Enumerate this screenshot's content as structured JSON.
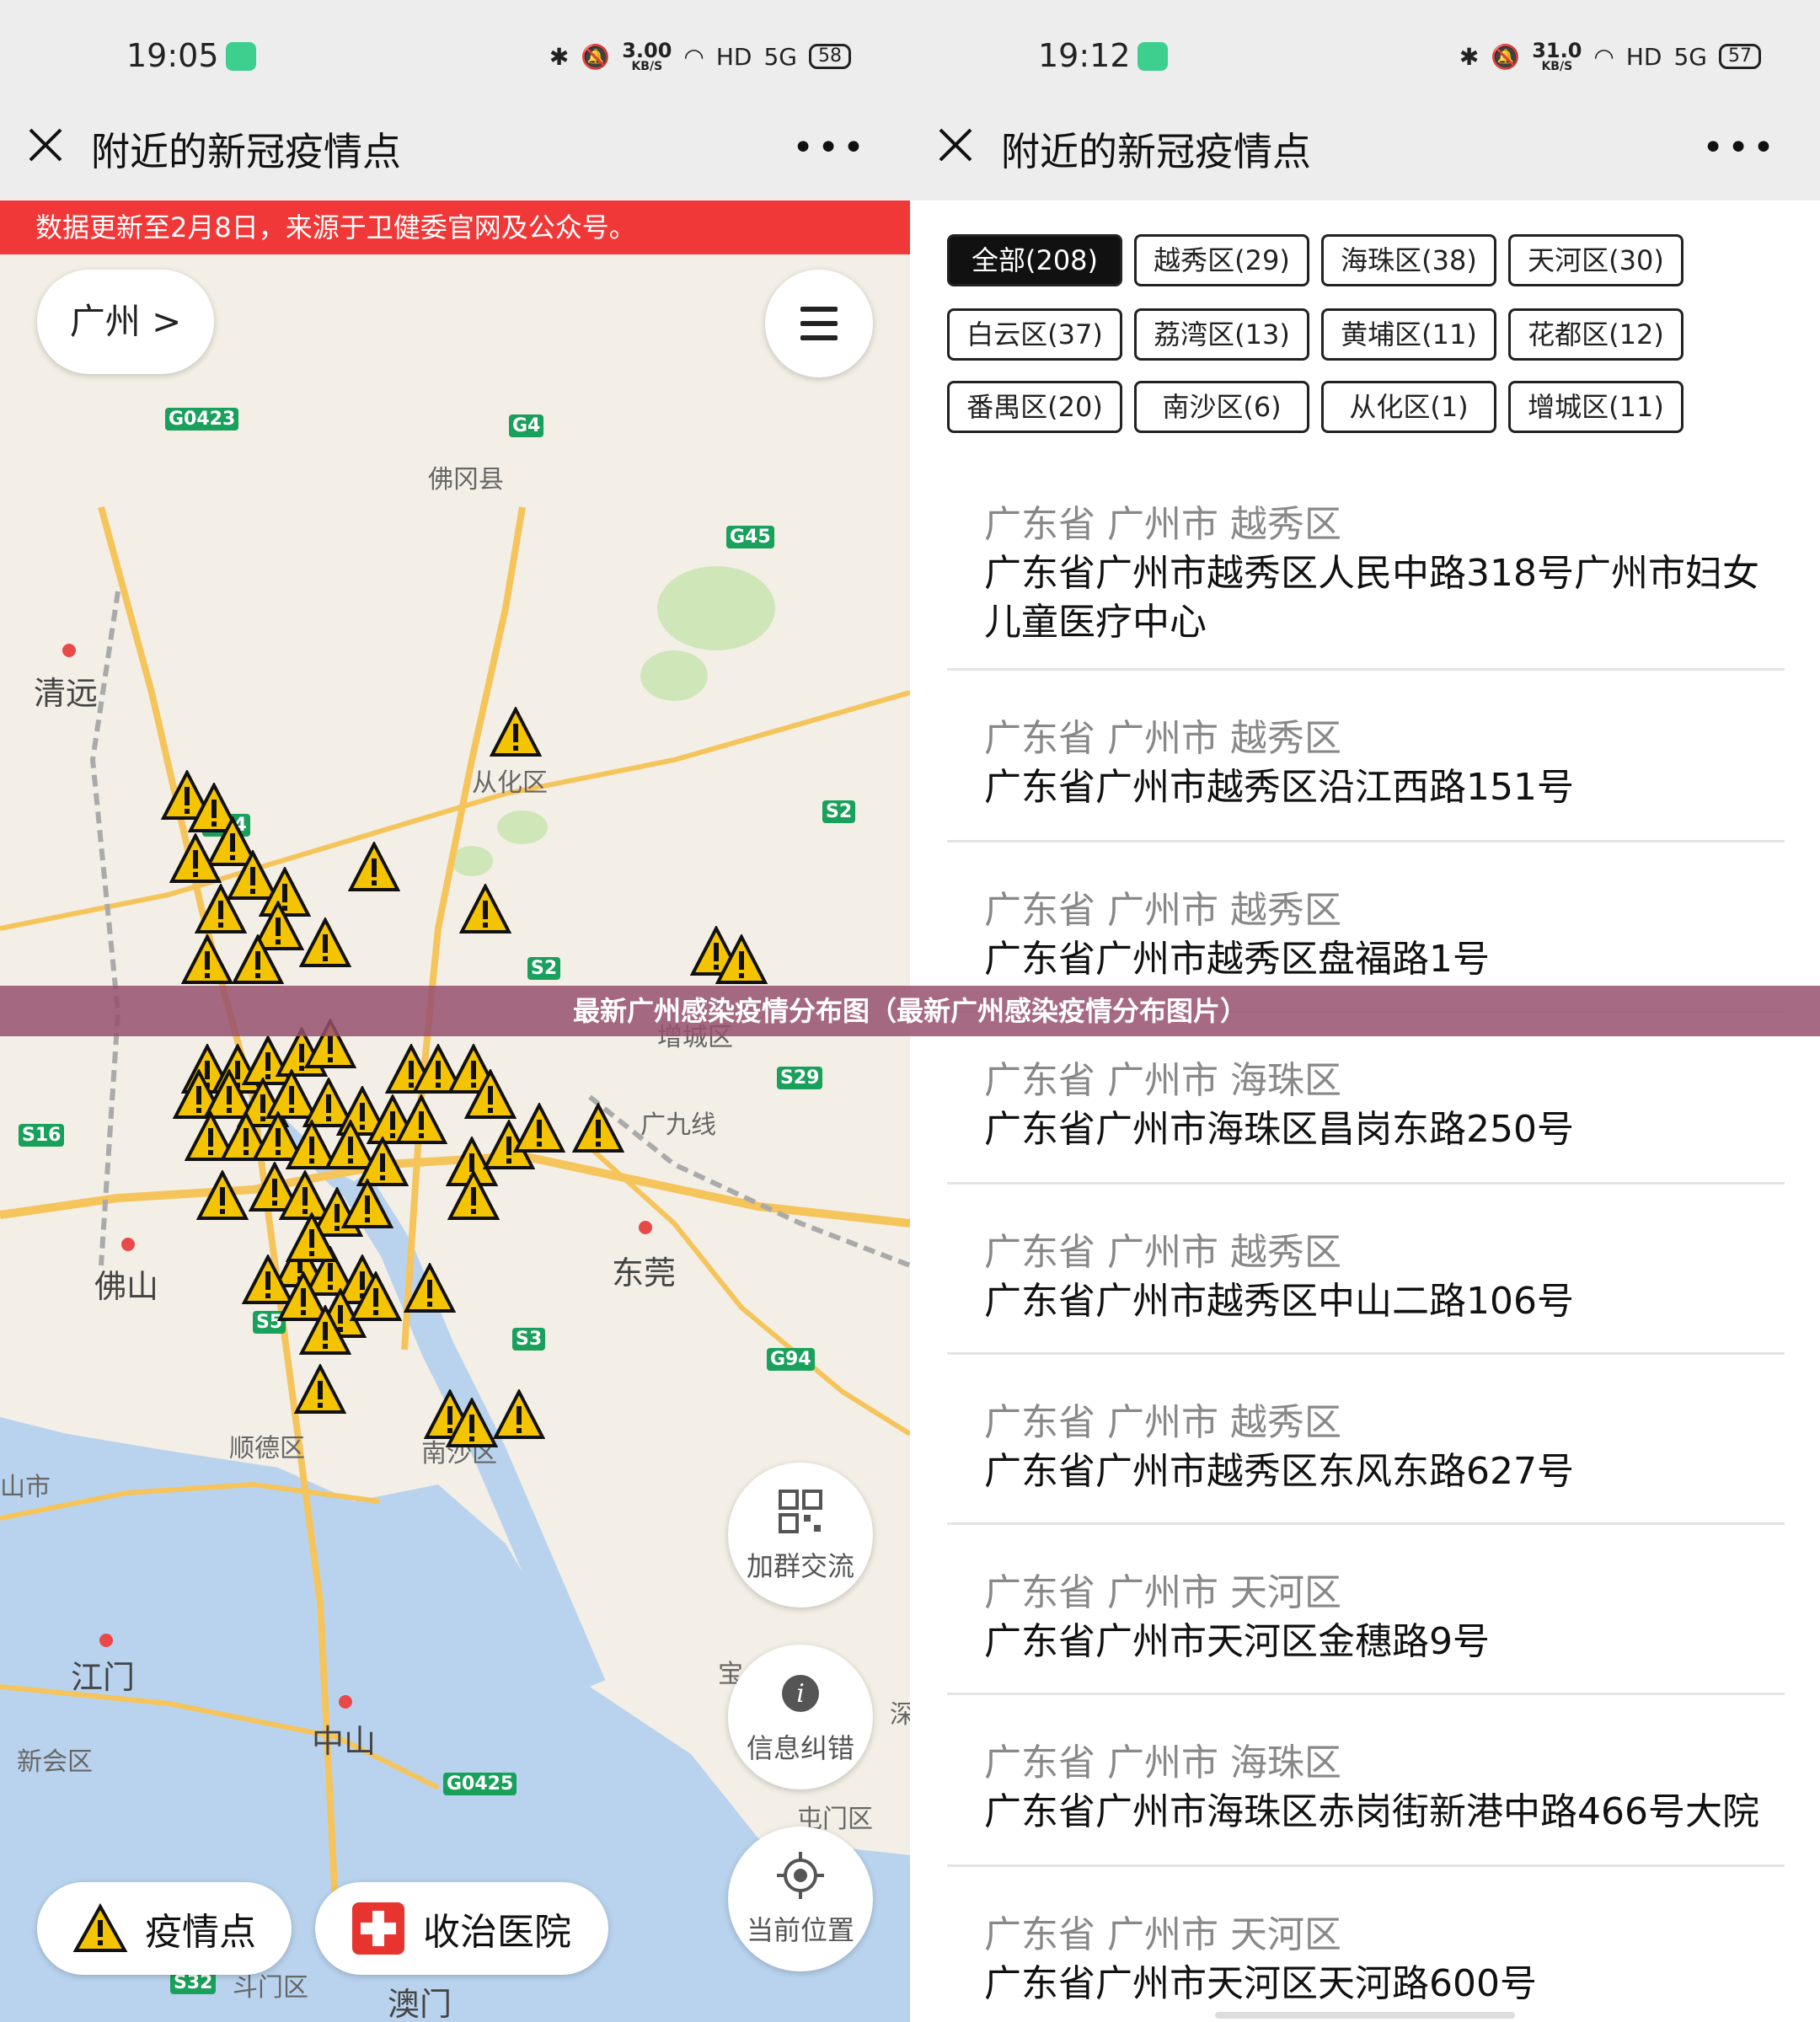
{
  "left": {
    "status": {
      "time": "19:05",
      "speed": "3.00",
      "speed_unit": "KB/S",
      "hd": "HD",
      "net": "5G",
      "battery": "58"
    },
    "title": "附近的新冠疫情点",
    "banner": "数据更新至2月8日，来源于卫健委官网及公众号。",
    "city_button": "广州 >",
    "map_labels": [
      "佛冈县",
      "清远",
      "从化区",
      "增城区",
      "广九线",
      "佛山",
      "东莞",
      "顺德区",
      "南沙区",
      "江门",
      "中山",
      "新会区",
      "斗门区",
      "屯门区",
      "澳门",
      "山市",
      "宝",
      "深"
    ],
    "highways": [
      "G0423",
      "G4",
      "G45",
      "S2",
      "S2",
      "S29",
      "S16",
      "S3",
      "G94",
      "G0425",
      "S32",
      "S5",
      "G94"
    ],
    "fabs": {
      "group": "加群交流",
      "report": "信息纠错",
      "locate": "当前位置"
    },
    "legend": {
      "points": "疫情点",
      "hospitals": "收治医院"
    }
  },
  "right": {
    "status": {
      "time": "19:12",
      "speed": "31.0",
      "speed_unit": "KB/S",
      "hd": "HD",
      "net": "5G",
      "battery": "57"
    },
    "title": "附近的新冠疫情点",
    "tabs": [
      "全部(208)",
      "越秀区(29)",
      "海珠区(38)",
      "天河区(30)",
      "白云区(37)",
      "荔湾区(13)",
      "黄埔区(11)",
      "花都区(12)",
      "番禺区(20)",
      "南沙区(6)",
      "从化区(1)",
      "增城区(11)"
    ],
    "items": [
      {
        "region": "广东省 广州市 越秀区",
        "address": "广东省广州市越秀区人民中路318号广州市妇女儿童医疗中心"
      },
      {
        "region": "广东省 广州市 越秀区",
        "address": "广东省广州市越秀区沿江西路151号"
      },
      {
        "region": "广东省 广州市 越秀区",
        "address": "广东省广州市越秀区盘福路1号"
      },
      {
        "region": "广东省 广州市 海珠区",
        "address": "广东省广州市海珠区昌岗东路250号"
      },
      {
        "region": "广东省 广州市 越秀区",
        "address": "广东省广州市越秀区中山二路106号"
      },
      {
        "region": "广东省 广州市 越秀区",
        "address": "广东省广州市越秀区东风东路627号"
      },
      {
        "region": "广东省 广州市 天河区",
        "address": "广东省广州市天河区金穗路9号"
      },
      {
        "region": "广东省 广州市 海珠区",
        "address": "广东省广州市海珠区赤岗街新港中路466号大院"
      },
      {
        "region": "广东省 广州市 天河区",
        "address": "广东省广州市天河区天河路600号"
      }
    ]
  },
  "overlay_caption": "最新广州感染疫情分布图（最新广州感染疫情分布图片）",
  "colors": {
    "banner": "#f13838",
    "warn": "#f5c400",
    "highway": "#19a05a",
    "water": "#b9d3ee",
    "road": "#f5c45a"
  }
}
